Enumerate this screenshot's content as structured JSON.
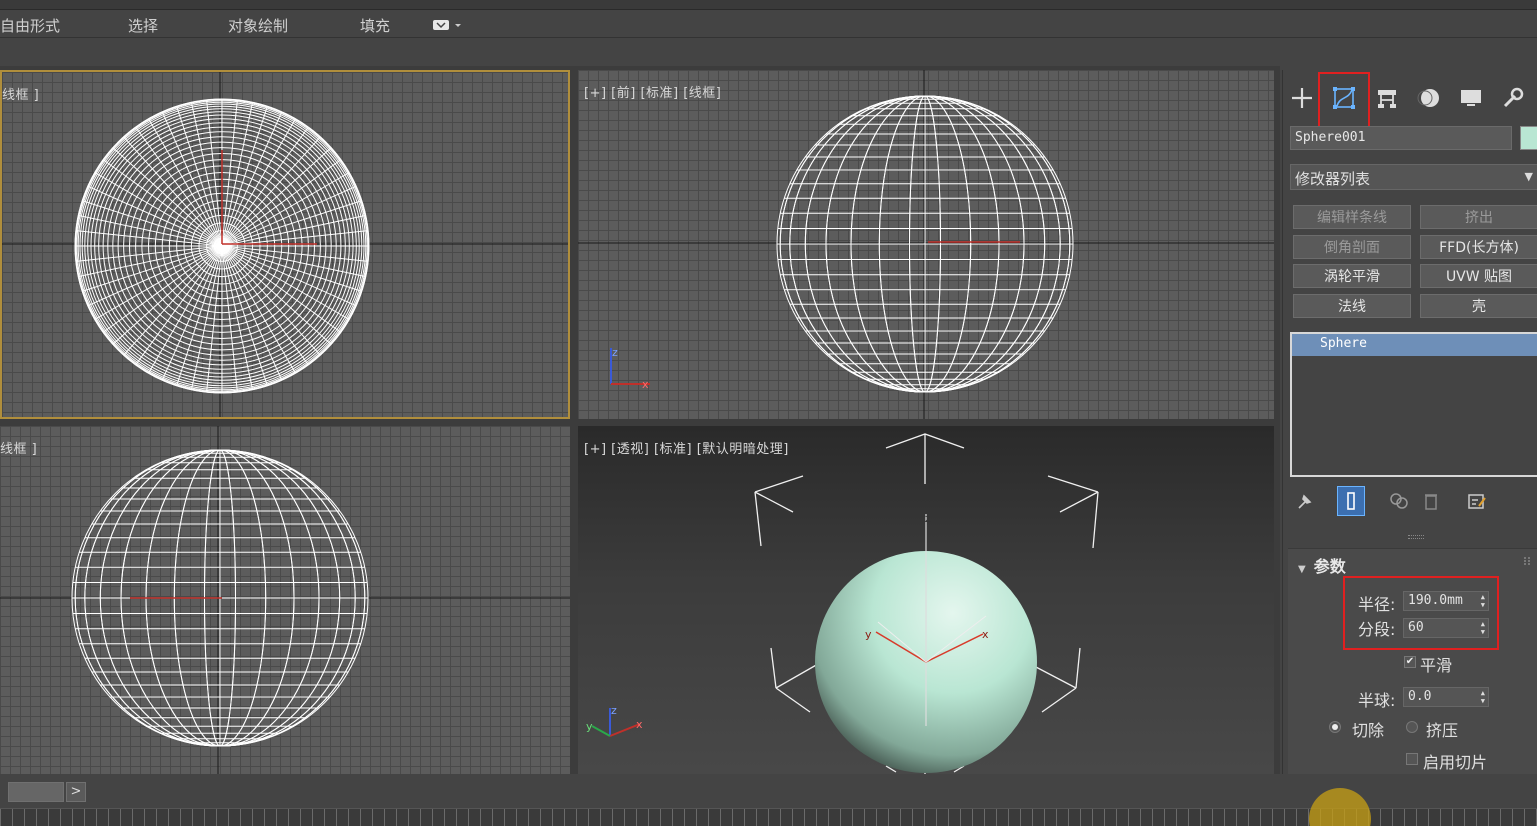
{
  "menu": {
    "items": [
      "自由形式",
      "选择",
      "对象绘制",
      "填充"
    ]
  },
  "viewports": {
    "top_label": "线框 ]",
    "front_label": "[+] [前] [标准] [线框]",
    "left_label": "线框 ]",
    "persp_label": "[+] [透视] [标准] [默认明暗处理]",
    "axis_z": "z",
    "axis_x": "x",
    "axis_y": "y"
  },
  "command_panel": {
    "tabs": [
      "create-icon",
      "modify-icon",
      "hierarchy-icon",
      "motion-icon",
      "display-icon",
      "utilities-icon"
    ],
    "object_name": "Sphere001",
    "object_color": "#b9e6d3",
    "modifier_list": "修改器列表",
    "modifier_buttons": [
      "编辑样条线",
      "挤出",
      "倒角剖面",
      "FFD(长方体)",
      "涡轮平滑",
      "UVW 贴图",
      "法线",
      "壳"
    ],
    "stack_item": "Sphere",
    "stack_tools": [
      "pin-icon",
      "show-end-result-icon",
      "make-unique-icon",
      "remove-modifier-icon",
      "configure-icon"
    ],
    "rollout_title": "参数",
    "radius_label": "半径:",
    "radius_value": "190.0mm",
    "segments_label": "分段:",
    "segments_value": "60",
    "smooth_label": "平滑",
    "hemisphere_label": "半球:",
    "hemisphere_value": "0.0",
    "chop_label": "切除",
    "squash_label": "挤压",
    "slice_label": "启用切片"
  },
  "colors": {
    "highlight": "#e02020",
    "active_viewport": "#b08e3c",
    "selected_stack": "#6e8fb8",
    "sphere": "#b9e6d3"
  }
}
